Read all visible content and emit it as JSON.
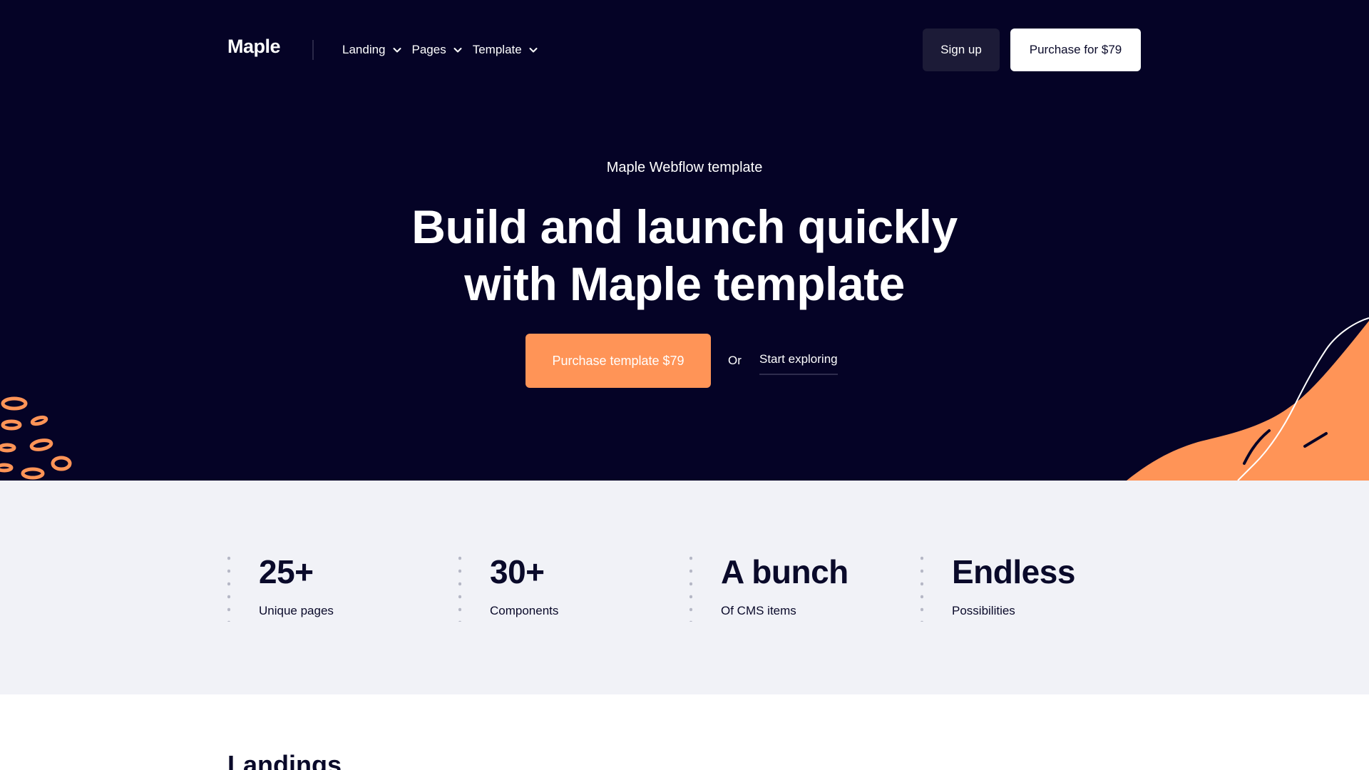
{
  "brand": {
    "logo_text": "Maple"
  },
  "nav": {
    "items": [
      {
        "label": "Landing"
      },
      {
        "label": "Pages"
      },
      {
        "label": "Template"
      }
    ]
  },
  "header_actions": {
    "signup_label": "Sign up",
    "purchase_label": "Purchase for $79"
  },
  "hero": {
    "eyebrow": "Maple Webflow template",
    "headline_line1": "Build and launch quickly",
    "headline_line2": "with Maple template",
    "primary_cta": "Purchase template $79",
    "or_text": "Or",
    "secondary_cta": "Start exploring"
  },
  "stats": [
    {
      "value": "25+",
      "label": "Unique pages"
    },
    {
      "value": "30+",
      "label": "Components"
    },
    {
      "value": "A bunch",
      "label": "Of CMS items"
    },
    {
      "value": "Endless",
      "label": "Possibilities"
    }
  ],
  "sections": {
    "landings_title": "Landings"
  },
  "colors": {
    "hero_bg": "#050326",
    "accent": "#ff9457",
    "stats_bg": "#f1f2f7",
    "text_dark": "#0a0a2a"
  },
  "icons": {
    "nav_dropdown": "chevron-down-icon"
  }
}
